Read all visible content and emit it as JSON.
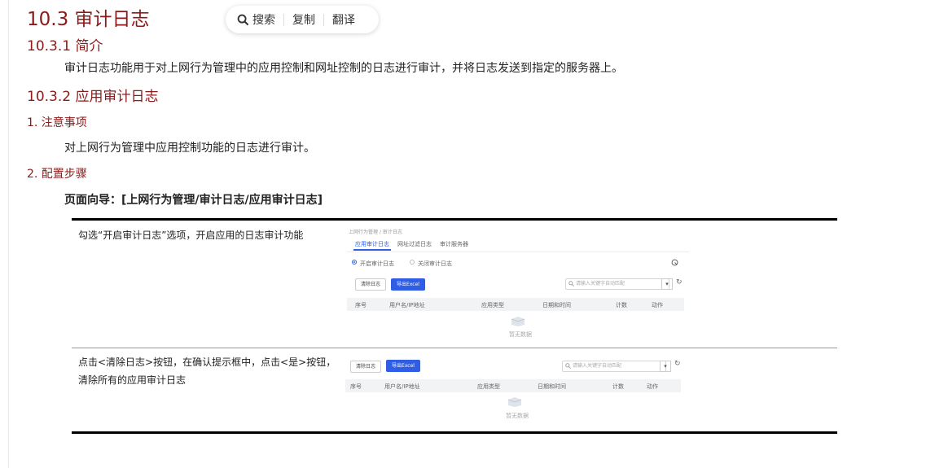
{
  "heading": "10.3  审计日志",
  "popup": {
    "search": "搜索",
    "copy": "复制",
    "translate": "翻译"
  },
  "sec1": {
    "title": "10.3.1  简介",
    "text": "审计日志功能用于对上网行为管理中的应用控制和网址控制的日志进行审计，并将日志发送到指定的服务器上。"
  },
  "sec2": {
    "title": "10.3.2  应用审计日志",
    "note_title": "1. 注意事项",
    "note_text": "对上网行为管理中应用控制功能的日志进行审计。",
    "steps_title": "2. 配置步骤",
    "nav": "页面向导：[上网行为管理/审计日志/应用审计日志]"
  },
  "rows": [
    {
      "text": "勾选“开启审计日志”选项，开启应用的日志审计功能"
    },
    {
      "text": "点击<清除日志>按钮，在确认提示框中，点击<是>按钮，清除所有的应用审计日志"
    }
  ],
  "shot": {
    "breadcrumb": "上网行为管理 / 审计日志",
    "tabs": [
      "应用审计日志",
      "网址过滤日志",
      "审计服务器"
    ],
    "radio_on": "开启审计日志",
    "radio_off": "关闭审计日志",
    "btn_clear": "清除日志",
    "btn_export": "导出Excel",
    "search_placeholder": "请输入关键字自动匹配",
    "columns": [
      "序号",
      "用户名/IP地址",
      "应用类型",
      "日期和时间",
      "计数",
      "动作"
    ],
    "empty": "暂无数据"
  },
  "colors": {
    "heading": "#8b1a1a",
    "accent": "#2f5ee5"
  }
}
